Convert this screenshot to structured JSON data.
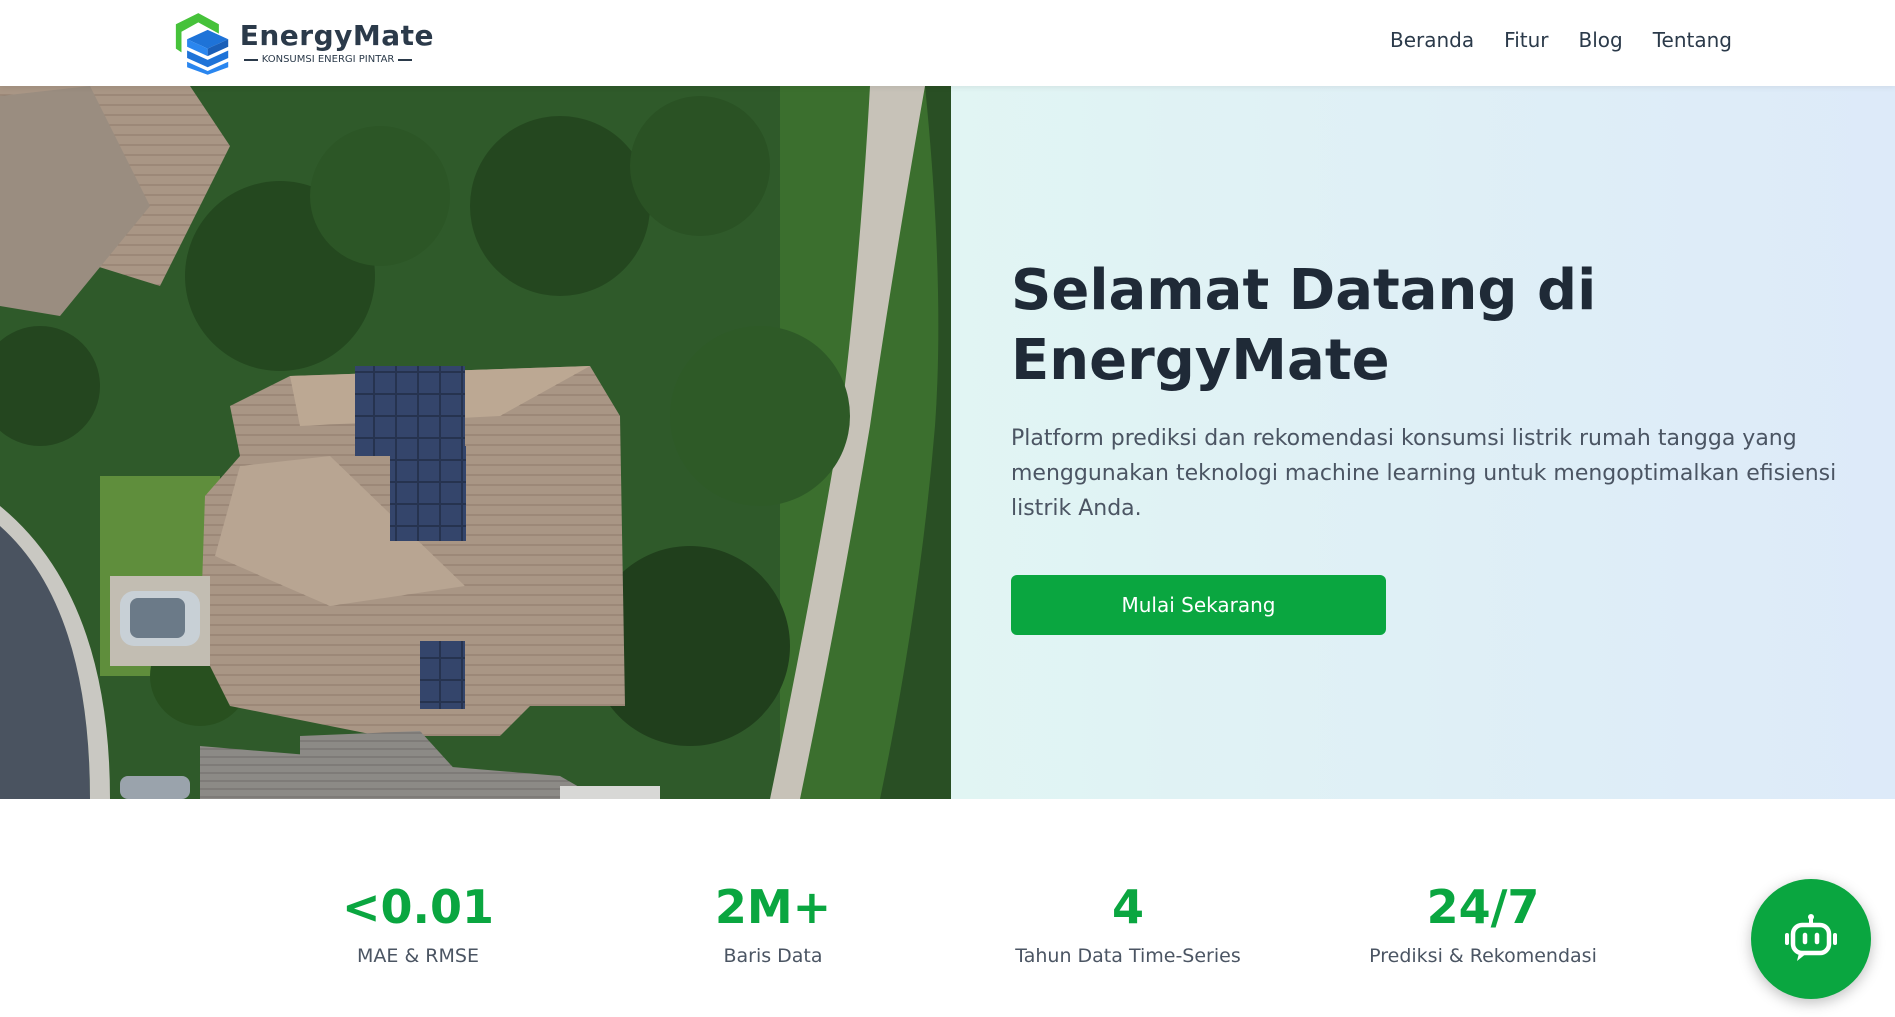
{
  "header": {
    "brand": "EnergyMate",
    "tagline": "KONSUMSI ENERGI PINTAR",
    "nav": [
      "Beranda",
      "Fitur",
      "Blog",
      "Tentang"
    ]
  },
  "hero": {
    "title": "Selamat Datang di EnergyMate",
    "description": "Platform prediksi dan rekomendasi konsumsi listrik rumah tangga yang menggunakan teknologi machine learning untuk mengoptimalkan efisiensi listrik Anda.",
    "cta": "Mulai Sekarang",
    "image_icon": "aerial-house-solar-panels-image"
  },
  "stats": [
    {
      "value": "<0.01",
      "label": "MAE & RMSE"
    },
    {
      "value": "2M+",
      "label": "Baris Data"
    },
    {
      "value": "4",
      "label": "Tahun Data Time-Series"
    },
    {
      "value": "24/7",
      "label": "Prediksi & Rekomendasi"
    }
  ],
  "fab": {
    "icon": "chatbot-icon"
  },
  "colors": {
    "accent": "#0aa640",
    "heading": "#1f2a37",
    "text": "#4b5563"
  }
}
